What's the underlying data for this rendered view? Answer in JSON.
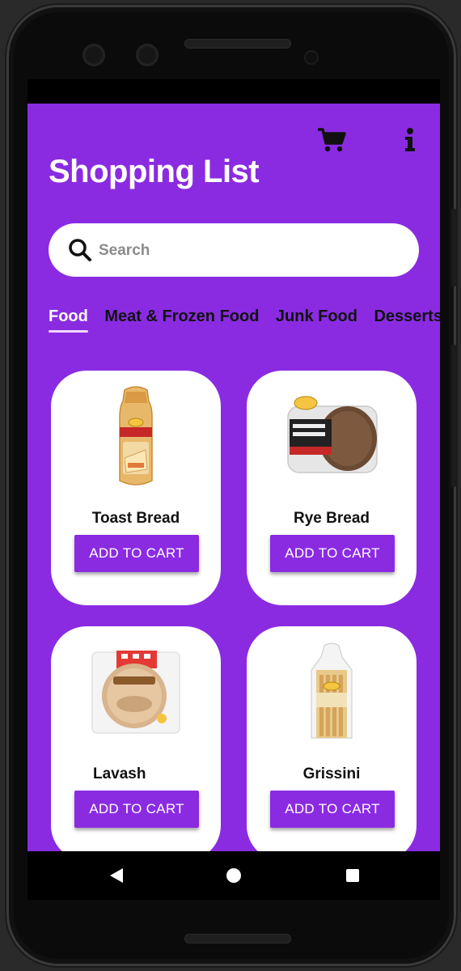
{
  "app": {
    "title": "Shopping List",
    "cart_icon": "cart-icon",
    "info_icon": "info-icon"
  },
  "search": {
    "placeholder": "Search",
    "value": "",
    "icon": "search-icon"
  },
  "tabs": [
    {
      "label": "Food",
      "active": true
    },
    {
      "label": "Meat & Frozen Food",
      "active": false
    },
    {
      "label": "Junk Food",
      "active": false
    },
    {
      "label": "Desserts",
      "active": false
    }
  ],
  "products": [
    {
      "name": "Toast Bread",
      "button": "ADD TO CART"
    },
    {
      "name": "Rye Bread",
      "button": "ADD TO CART"
    },
    {
      "name": "Lavash",
      "button": "ADD TO CART"
    },
    {
      "name": "Grissini",
      "button": "ADD TO CART"
    }
  ],
  "colors": {
    "accent": "#8a2be2",
    "card": "#ffffff",
    "tab_active": "#ffffff",
    "tab_inactive": "#111111"
  }
}
